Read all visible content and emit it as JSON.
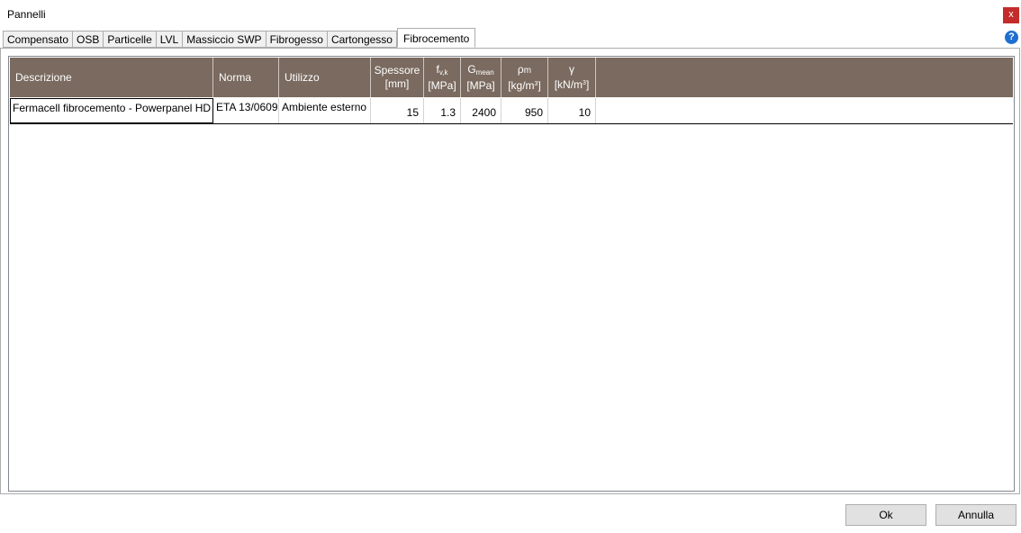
{
  "window": {
    "title": "Pannelli",
    "close_label": "x",
    "help_label": "?"
  },
  "tabs": [
    {
      "label": "Compensato"
    },
    {
      "label": "OSB"
    },
    {
      "label": "Particelle"
    },
    {
      "label": "LVL"
    },
    {
      "label": "Massiccio SWP"
    },
    {
      "label": "Fibrogesso"
    },
    {
      "label": "Cartongesso"
    },
    {
      "label": "Fibrocemento",
      "active": true
    }
  ],
  "table": {
    "headers": {
      "descrizione": "Descrizione",
      "norma": "Norma",
      "utilizzo": "Utilizzo",
      "spessore_name": "Spessore",
      "spessore_unit": "[mm]",
      "fvk_main": "f",
      "fvk_sub": "v,k",
      "fvk_unit": "[MPa]",
      "gmean_main": "G",
      "gmean_sub": "mean",
      "gmean_unit": "[MPa]",
      "rho_main": "ρ",
      "rho_sub": "m",
      "rho_unit": "[kg/m",
      "rho_unit_sup": "3",
      "rho_unit_end": "]",
      "gamma_main": "γ",
      "gamma_unit": "[kN/m",
      "gamma_unit_sup": "3",
      "gamma_unit_end": "]"
    },
    "rows": [
      {
        "descrizione": "Fermacell fibrocemento - Powerpanel HD",
        "norma": "ETA 13/0609",
        "utilizzo": "Ambiente esterno",
        "spessore": "15",
        "fvk": "1.3",
        "gmean": "2400",
        "rho": "950",
        "gamma": "10"
      }
    ]
  },
  "buttons": {
    "ok": "Ok",
    "cancel": "Annulla"
  },
  "colors": {
    "header_bg": "#7a6a5f",
    "close_bg": "#c42b2b",
    "help_bg": "#1e6fd1"
  }
}
